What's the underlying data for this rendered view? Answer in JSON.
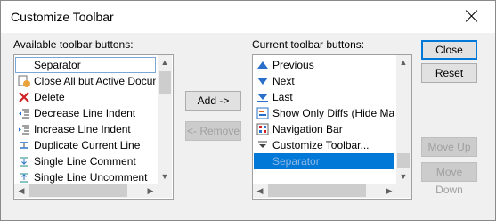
{
  "window": {
    "title": "Customize Toolbar"
  },
  "available": {
    "label": "Available toolbar buttons:",
    "items": [
      {
        "label": "Separator",
        "icon": "separator-icon"
      },
      {
        "label": "Close All but Active Document",
        "icon": "close-all-icon"
      },
      {
        "label": "Delete",
        "icon": "delete-x-icon"
      },
      {
        "label": "Decrease Line Indent",
        "icon": "decrease-indent-icon"
      },
      {
        "label": "Increase Line Indent",
        "icon": "increase-indent-icon"
      },
      {
        "label": "Duplicate Current Line",
        "icon": "duplicate-line-icon"
      },
      {
        "label": "Single Line Comment",
        "icon": "comment-icon"
      },
      {
        "label": "Single Line Uncomment",
        "icon": "uncomment-icon"
      }
    ]
  },
  "current": {
    "label": "Current toolbar buttons:",
    "items": [
      {
        "label": "Previous",
        "icon": "arrow-up-icon"
      },
      {
        "label": "Next",
        "icon": "arrow-down-icon"
      },
      {
        "label": "Last",
        "icon": "last-icon"
      },
      {
        "label": "Show Only Diffs (Hide Matches)",
        "icon": "show-diffs-icon"
      },
      {
        "label": "Navigation Bar",
        "icon": "navigation-bar-icon"
      },
      {
        "label": "Customize Toolbar...",
        "icon": "customize-dropdown-icon"
      },
      {
        "label": "Separator",
        "icon": "separator-icon",
        "selected": true
      }
    ]
  },
  "buttons": {
    "add": "Add ->",
    "remove": "<- Remove",
    "close": "Close",
    "reset": "Reset",
    "move_up": "Move Up",
    "move_down": "Move Down"
  },
  "colors": {
    "selection": "#0078d7",
    "accent": "#0078d7"
  }
}
